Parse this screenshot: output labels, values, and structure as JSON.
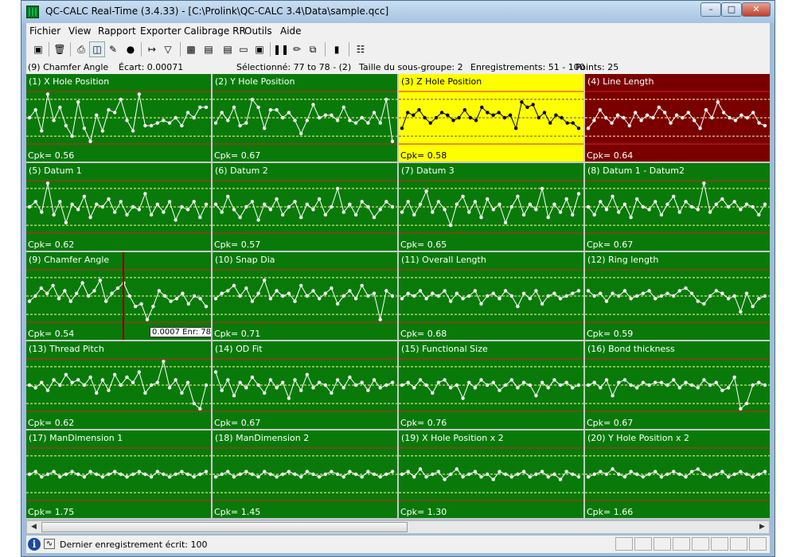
{
  "window": {
    "title": "QC-CALC Real-Time (3.4.33)  - [C:\\Prolink\\QC-CALC 3.4\\Data\\sample.qcc]"
  },
  "menu": [
    "Fichier",
    "View",
    "Rapport",
    "Exporter",
    "Calibrage RR",
    "Outils",
    "Aide"
  ],
  "toolbar_icons": [
    "select-icon",
    "delete-icon",
    "print-icon",
    "print-preview-icon",
    "edit-icon",
    "lock-icon",
    "goto-icon",
    "filter-icon",
    "chart-icon",
    "chart-settings-icon",
    "document-icon",
    "note-icon",
    "window-icon",
    "pause-icon",
    "pencil-icon",
    "copy-icon",
    "histogram-icon",
    "report-icon"
  ],
  "info": {
    "feature": "(9) Chamfer Angle",
    "ecart": "Écart: 0.00071",
    "selected": "Sélectionné: 77 to 78 - (2)",
    "subgroup": "Taille du sous-groupe: 2",
    "records": "Enregistrements: 51 - 100",
    "points": "Points: 25"
  },
  "colors": {
    "ok": "#097a0a",
    "warning": "#ffff00",
    "fail": "#7a0000",
    "centerline": "#ffff99",
    "limit": "#d32020"
  },
  "panels": [
    {
      "title": "(1) X Hole Position",
      "cpk": "Cpk= 0.56",
      "status": "ok",
      "values": [
        0.5,
        0.65,
        0.25,
        0.95,
        0.45,
        0.7,
        0.35,
        0.15,
        0.8,
        0.3,
        0.05,
        0.55,
        0.25,
        0.65,
        0.6,
        0.85,
        0.45,
        0.25,
        0.95,
        0.35,
        0.35,
        0.4,
        0.45,
        0.4,
        0.5,
        0.35,
        0.6,
        0.5,
        0.7,
        0.7
      ]
    },
    {
      "title": "(2) Y Hole Position",
      "cpk": "Cpk= 0.67",
      "status": "ok",
      "values": [
        0.4,
        0.6,
        0.45,
        0.7,
        0.35,
        0.4,
        0.85,
        0.7,
        0.3,
        0.65,
        0.65,
        0.5,
        0.6,
        0.45,
        0.2,
        0.45,
        0.75,
        0.5,
        0.55,
        0.55,
        0.45,
        0.7,
        0.45,
        0.4,
        0.5,
        0.4,
        0.6,
        0.4,
        0.85,
        0.05
      ]
    },
    {
      "title": "(3) Z Hole Position",
      "cpk": "Cpk= 0.58",
      "status": "warn",
      "values": [
        0.3,
        0.6,
        0.55,
        0.65,
        0.5,
        0.4,
        0.5,
        0.6,
        0.55,
        0.45,
        0.5,
        0.65,
        0.5,
        0.45,
        0.7,
        0.6,
        0.55,
        0.6,
        0.5,
        0.55,
        0.3,
        0.8,
        0.7,
        0.75,
        0.5,
        0.6,
        0.4,
        0.55,
        0.5,
        0.4,
        0.4,
        0.3
      ]
    },
    {
      "title": "(4) Line Length",
      "cpk": "Cpk= 0.64",
      "status": "bad",
      "values": [
        0.3,
        0.45,
        0.65,
        0.5,
        0.4,
        0.55,
        0.5,
        0.35,
        0.6,
        0.45,
        0.55,
        0.5,
        0.7,
        0.6,
        0.4,
        0.55,
        0.5,
        0.6,
        0.45,
        0.3,
        0.65,
        0.5,
        0.8,
        0.6,
        0.5,
        0.45,
        0.55,
        0.5,
        0.6,
        0.4,
        0.35
      ]
    },
    {
      "title": "(5) Datum 1",
      "cpk": "Cpk= 0.62",
      "status": "ok",
      "values": [
        0.5,
        0.6,
        0.4,
        0.95,
        0.35,
        0.6,
        0.2,
        0.55,
        0.45,
        0.7,
        0.3,
        0.55,
        0.5,
        0.65,
        0.4,
        0.6,
        0.35,
        0.5,
        0.45,
        0.75,
        0.35,
        0.55,
        0.4,
        0.6,
        0.25,
        0.5,
        0.45,
        0.6,
        0.3,
        0.55
      ]
    },
    {
      "title": "(6) Datum 2",
      "cpk": "Cpk= 0.57",
      "status": "ok",
      "values": [
        0.55,
        0.4,
        0.7,
        0.45,
        0.3,
        0.5,
        0.6,
        0.25,
        0.55,
        0.45,
        0.65,
        0.35,
        0.5,
        0.6,
        0.3,
        0.55,
        0.45,
        0.65,
        0.35,
        0.5,
        0.85,
        0.4,
        0.55,
        0.35,
        0.6,
        0.5,
        0.3,
        0.45,
        0.6,
        0.5
      ]
    },
    {
      "title": "(7) Datum 3",
      "cpk": "Cpk= 0.65",
      "status": "ok",
      "values": [
        0.4,
        0.6,
        0.35,
        0.55,
        0.8,
        0.4,
        0.6,
        0.45,
        0.15,
        0.55,
        0.7,
        0.4,
        0.6,
        0.3,
        0.65,
        0.45,
        0.55,
        0.2,
        0.5,
        0.7,
        0.35,
        0.55,
        0.45,
        0.85,
        0.3,
        0.55,
        0.4,
        0.65,
        0.35,
        0.75
      ]
    },
    {
      "title": "(8) Datum 1 - Datum2",
      "cpk": "Cpk= 0.67",
      "status": "ok",
      "values": [
        0.5,
        0.35,
        0.6,
        0.45,
        0.7,
        0.4,
        0.55,
        0.3,
        0.65,
        0.5,
        0.45,
        0.6,
        0.35,
        0.55,
        0.7,
        0.4,
        0.6,
        0.5,
        0.45,
        0.95,
        0.4,
        0.55,
        0.65,
        0.5,
        0.6,
        0.45,
        0.55,
        0.5,
        0.35,
        0.55
      ]
    },
    {
      "title": "(9) Chamfer Angle",
      "cpk": "Cpk= 0.54",
      "status": "ok",
      "values": [
        0.4,
        0.5,
        0.65,
        0.55,
        0.7,
        0.45,
        0.6,
        0.4,
        0.55,
        0.75,
        0.5,
        0.6,
        0.8,
        0.4,
        0.55,
        0.65,
        0.75,
        0.5,
        0.3,
        0.35,
        0.05,
        0.3,
        0.6,
        0.5,
        0.4,
        0.45,
        0.55,
        0.35,
        0.5,
        0.45,
        0.3
      ]
    },
    {
      "title": "(10) Snap Dia",
      "cpk": "Cpk= 0.71",
      "status": "ok",
      "values": [
        0.45,
        0.55,
        0.6,
        0.7,
        0.5,
        0.65,
        0.4,
        0.55,
        0.8,
        0.45,
        0.6,
        0.5,
        0.55,
        0.4,
        0.7,
        0.5,
        0.6,
        0.45,
        0.55,
        0.65,
        0.35,
        0.5,
        0.6,
        0.45,
        0.7,
        0.5,
        0.55,
        0.05,
        0.6,
        0.5
      ]
    },
    {
      "title": "(11) Overall Length",
      "cpk": "Cpk= 0.68",
      "status": "ok",
      "values": [
        0.45,
        0.55,
        0.5,
        0.6,
        0.45,
        0.55,
        0.5,
        0.6,
        0.4,
        0.55,
        0.45,
        0.5,
        0.6,
        0.35,
        0.5,
        0.55,
        0.45,
        0.6,
        0.5,
        0.3,
        0.55,
        0.45,
        0.6,
        0.35,
        0.5,
        0.55,
        0.45,
        0.5,
        0.55,
        0.6
      ]
    },
    {
      "title": "(12) Ring length",
      "cpk": "Cpk= 0.59",
      "status": "ok",
      "values": [
        0.6,
        0.5,
        0.55,
        0.4,
        0.55,
        0.5,
        0.6,
        0.45,
        0.5,
        0.55,
        0.6,
        0.45,
        0.5,
        0.55,
        0.5,
        0.6,
        0.65,
        0.55,
        0.4,
        0.35,
        0.5,
        0.6,
        0.55,
        0.45,
        0.5,
        0.2,
        0.55,
        0.3,
        0.45,
        0.5
      ]
    },
    {
      "title": "(13) Thread Pitch",
      "cpk": "Cpk= 0.62",
      "status": "ok",
      "values": [
        0.5,
        0.45,
        0.55,
        0.4,
        0.6,
        0.5,
        0.7,
        0.55,
        0.6,
        0.5,
        0.65,
        0.35,
        0.6,
        0.4,
        0.7,
        0.5,
        0.65,
        0.55,
        0.75,
        0.35,
        0.5,
        0.55,
        0.95,
        0.45,
        0.6,
        0.35,
        0.55,
        0.15,
        0.05,
        0.5
      ]
    },
    {
      "title": "(14) OD Fit",
      "cpk": "Cpk= 0.67",
      "status": "ok",
      "values": [
        0.75,
        0.4,
        0.6,
        0.3,
        0.55,
        0.45,
        0.65,
        0.5,
        0.35,
        0.6,
        0.45,
        0.55,
        0.25,
        0.6,
        0.4,
        0.7,
        0.45,
        0.55,
        0.5,
        0.35,
        0.6,
        0.45,
        0.65,
        0.5,
        0.55,
        0.4,
        0.6,
        0.45,
        0.5,
        0.55
      ]
    },
    {
      "title": "(15) Functional Size",
      "cpk": "Cpk= 0.76",
      "status": "ok",
      "values": [
        0.5,
        0.55,
        0.45,
        0.6,
        0.5,
        0.35,
        0.55,
        0.6,
        0.45,
        0.5,
        0.25,
        0.55,
        0.45,
        0.6,
        0.5,
        0.55,
        0.4,
        0.5,
        0.6,
        0.45,
        0.55,
        0.5,
        0.3,
        0.55,
        0.45,
        0.6,
        0.5,
        0.55,
        0.45,
        0.5
      ]
    },
    {
      "title": "(16) Bond thickness",
      "cpk": "Cpk= 0.67",
      "status": "ok",
      "values": [
        0.5,
        0.55,
        0.45,
        0.6,
        0.3,
        0.55,
        0.6,
        0.5,
        0.45,
        0.55,
        0.5,
        0.55,
        0.55,
        0.5,
        0.6,
        0.45,
        0.55,
        0.5,
        0.45,
        0.6,
        0.5,
        0.55,
        0.4,
        0.45,
        0.65,
        0.05,
        0.15,
        0.5,
        0.55,
        0.5
      ]
    },
    {
      "title": "(17) ManDimension 1",
      "cpk": "Cpk= 1.75",
      "status": "ok",
      "values": [
        0.5,
        0.55,
        0.45,
        0.5,
        0.55,
        0.45,
        0.5,
        0.55,
        0.5,
        0.45,
        0.55,
        0.5,
        0.45,
        0.5,
        0.55,
        0.5,
        0.45,
        0.5,
        0.55,
        0.5,
        0.45,
        0.55,
        0.5,
        0.45,
        0.5,
        0.55,
        0.5,
        0.45,
        0.5,
        0.55
      ]
    },
    {
      "title": "(18) ManDimension 2",
      "cpk": "Cpk= 1.45",
      "status": "ok",
      "values": [
        0.45,
        0.5,
        0.55,
        0.45,
        0.5,
        0.55,
        0.5,
        0.45,
        0.55,
        0.5,
        0.45,
        0.5,
        0.55,
        0.5,
        0.45,
        0.55,
        0.5,
        0.45,
        0.5,
        0.55,
        0.5,
        0.45,
        0.55,
        0.5,
        0.45,
        0.55,
        0.5,
        0.45,
        0.5,
        0.55
      ]
    },
    {
      "title": "(19) X Hole Position x 2",
      "cpk": "Cpk= 1.30",
      "status": "ok",
      "values": [
        0.5,
        0.55,
        0.45,
        0.6,
        0.45,
        0.5,
        0.55,
        0.4,
        0.5,
        0.6,
        0.45,
        0.5,
        0.55,
        0.45,
        0.5,
        0.4,
        0.55,
        0.5,
        0.45,
        0.5,
        0.55,
        0.45,
        0.5,
        0.55,
        0.45,
        0.5,
        0.4,
        0.55,
        0.5,
        0.45
      ]
    },
    {
      "title": "(20) Y Hole Position x 2",
      "cpk": "Cpk= 1.66",
      "status": "ok",
      "values": [
        0.45,
        0.5,
        0.55,
        0.5,
        0.6,
        0.5,
        0.45,
        0.55,
        0.5,
        0.45,
        0.5,
        0.55,
        0.45,
        0.5,
        0.55,
        0.5,
        0.45,
        0.55,
        0.6,
        0.5,
        0.45,
        0.5,
        0.55,
        0.45,
        0.5,
        0.55,
        0.5,
        0.45,
        0.5,
        0.55
      ]
    }
  ],
  "tooltip": "0.0007 Enr: 78",
  "status": {
    "text": "Dernier enregistrement écrit: 100"
  }
}
